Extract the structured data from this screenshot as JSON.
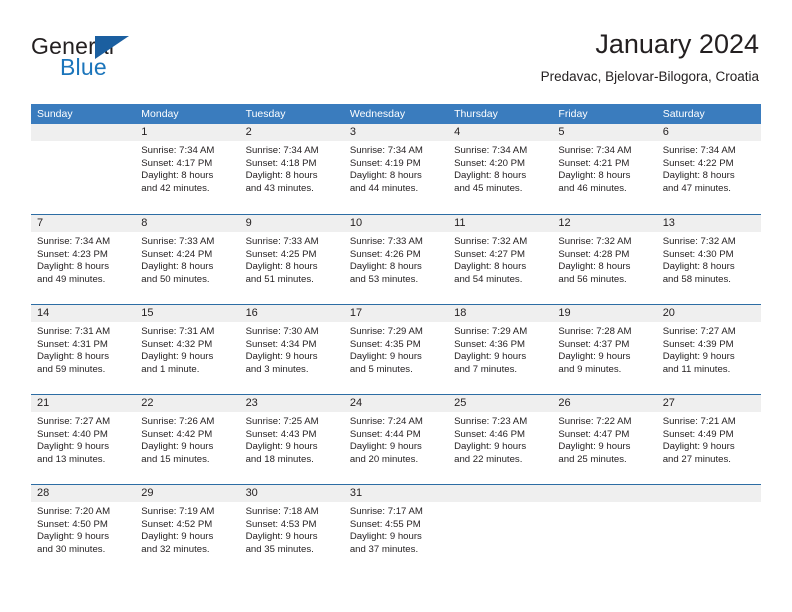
{
  "brand": {
    "name_part1": "General",
    "name_part2": "Blue"
  },
  "header": {
    "title": "January 2024",
    "subtitle": "Predavac, Bjelovar-Bilogora, Croatia"
  },
  "colors": {
    "header_blue": "#3a7cbe",
    "row_divider": "#2d6da4",
    "daynum_bg": "#efefef",
    "brand_blue": "#1b75bb",
    "text": "#231f20"
  },
  "weekdays": [
    "Sunday",
    "Monday",
    "Tuesday",
    "Wednesday",
    "Thursday",
    "Friday",
    "Saturday"
  ],
  "weeks": [
    [
      {
        "day": "",
        "sunrise": "",
        "sunset": "",
        "daylight1": "",
        "daylight2": ""
      },
      {
        "day": "1",
        "sunrise": "Sunrise: 7:34 AM",
        "sunset": "Sunset: 4:17 PM",
        "daylight1": "Daylight: 8 hours",
        "daylight2": "and 42 minutes."
      },
      {
        "day": "2",
        "sunrise": "Sunrise: 7:34 AM",
        "sunset": "Sunset: 4:18 PM",
        "daylight1": "Daylight: 8 hours",
        "daylight2": "and 43 minutes."
      },
      {
        "day": "3",
        "sunrise": "Sunrise: 7:34 AM",
        "sunset": "Sunset: 4:19 PM",
        "daylight1": "Daylight: 8 hours",
        "daylight2": "and 44 minutes."
      },
      {
        "day": "4",
        "sunrise": "Sunrise: 7:34 AM",
        "sunset": "Sunset: 4:20 PM",
        "daylight1": "Daylight: 8 hours",
        "daylight2": "and 45 minutes."
      },
      {
        "day": "5",
        "sunrise": "Sunrise: 7:34 AM",
        "sunset": "Sunset: 4:21 PM",
        "daylight1": "Daylight: 8 hours",
        "daylight2": "and 46 minutes."
      },
      {
        "day": "6",
        "sunrise": "Sunrise: 7:34 AM",
        "sunset": "Sunset: 4:22 PM",
        "daylight1": "Daylight: 8 hours",
        "daylight2": "and 47 minutes."
      }
    ],
    [
      {
        "day": "7",
        "sunrise": "Sunrise: 7:34 AM",
        "sunset": "Sunset: 4:23 PM",
        "daylight1": "Daylight: 8 hours",
        "daylight2": "and 49 minutes."
      },
      {
        "day": "8",
        "sunrise": "Sunrise: 7:33 AM",
        "sunset": "Sunset: 4:24 PM",
        "daylight1": "Daylight: 8 hours",
        "daylight2": "and 50 minutes."
      },
      {
        "day": "9",
        "sunrise": "Sunrise: 7:33 AM",
        "sunset": "Sunset: 4:25 PM",
        "daylight1": "Daylight: 8 hours",
        "daylight2": "and 51 minutes."
      },
      {
        "day": "10",
        "sunrise": "Sunrise: 7:33 AM",
        "sunset": "Sunset: 4:26 PM",
        "daylight1": "Daylight: 8 hours",
        "daylight2": "and 53 minutes."
      },
      {
        "day": "11",
        "sunrise": "Sunrise: 7:32 AM",
        "sunset": "Sunset: 4:27 PM",
        "daylight1": "Daylight: 8 hours",
        "daylight2": "and 54 minutes."
      },
      {
        "day": "12",
        "sunrise": "Sunrise: 7:32 AM",
        "sunset": "Sunset: 4:28 PM",
        "daylight1": "Daylight: 8 hours",
        "daylight2": "and 56 minutes."
      },
      {
        "day": "13",
        "sunrise": "Sunrise: 7:32 AM",
        "sunset": "Sunset: 4:30 PM",
        "daylight1": "Daylight: 8 hours",
        "daylight2": "and 58 minutes."
      }
    ],
    [
      {
        "day": "14",
        "sunrise": "Sunrise: 7:31 AM",
        "sunset": "Sunset: 4:31 PM",
        "daylight1": "Daylight: 8 hours",
        "daylight2": "and 59 minutes."
      },
      {
        "day": "15",
        "sunrise": "Sunrise: 7:31 AM",
        "sunset": "Sunset: 4:32 PM",
        "daylight1": "Daylight: 9 hours",
        "daylight2": "and 1 minute."
      },
      {
        "day": "16",
        "sunrise": "Sunrise: 7:30 AM",
        "sunset": "Sunset: 4:34 PM",
        "daylight1": "Daylight: 9 hours",
        "daylight2": "and 3 minutes."
      },
      {
        "day": "17",
        "sunrise": "Sunrise: 7:29 AM",
        "sunset": "Sunset: 4:35 PM",
        "daylight1": "Daylight: 9 hours",
        "daylight2": "and 5 minutes."
      },
      {
        "day": "18",
        "sunrise": "Sunrise: 7:29 AM",
        "sunset": "Sunset: 4:36 PM",
        "daylight1": "Daylight: 9 hours",
        "daylight2": "and 7 minutes."
      },
      {
        "day": "19",
        "sunrise": "Sunrise: 7:28 AM",
        "sunset": "Sunset: 4:37 PM",
        "daylight1": "Daylight: 9 hours",
        "daylight2": "and 9 minutes."
      },
      {
        "day": "20",
        "sunrise": "Sunrise: 7:27 AM",
        "sunset": "Sunset: 4:39 PM",
        "daylight1": "Daylight: 9 hours",
        "daylight2": "and 11 minutes."
      }
    ],
    [
      {
        "day": "21",
        "sunrise": "Sunrise: 7:27 AM",
        "sunset": "Sunset: 4:40 PM",
        "daylight1": "Daylight: 9 hours",
        "daylight2": "and 13 minutes."
      },
      {
        "day": "22",
        "sunrise": "Sunrise: 7:26 AM",
        "sunset": "Sunset: 4:42 PM",
        "daylight1": "Daylight: 9 hours",
        "daylight2": "and 15 minutes."
      },
      {
        "day": "23",
        "sunrise": "Sunrise: 7:25 AM",
        "sunset": "Sunset: 4:43 PM",
        "daylight1": "Daylight: 9 hours",
        "daylight2": "and 18 minutes."
      },
      {
        "day": "24",
        "sunrise": "Sunrise: 7:24 AM",
        "sunset": "Sunset: 4:44 PM",
        "daylight1": "Daylight: 9 hours",
        "daylight2": "and 20 minutes."
      },
      {
        "day": "25",
        "sunrise": "Sunrise: 7:23 AM",
        "sunset": "Sunset: 4:46 PM",
        "daylight1": "Daylight: 9 hours",
        "daylight2": "and 22 minutes."
      },
      {
        "day": "26",
        "sunrise": "Sunrise: 7:22 AM",
        "sunset": "Sunset: 4:47 PM",
        "daylight1": "Daylight: 9 hours",
        "daylight2": "and 25 minutes."
      },
      {
        "day": "27",
        "sunrise": "Sunrise: 7:21 AM",
        "sunset": "Sunset: 4:49 PM",
        "daylight1": "Daylight: 9 hours",
        "daylight2": "and 27 minutes."
      }
    ],
    [
      {
        "day": "28",
        "sunrise": "Sunrise: 7:20 AM",
        "sunset": "Sunset: 4:50 PM",
        "daylight1": "Daylight: 9 hours",
        "daylight2": "and 30 minutes."
      },
      {
        "day": "29",
        "sunrise": "Sunrise: 7:19 AM",
        "sunset": "Sunset: 4:52 PM",
        "daylight1": "Daylight: 9 hours",
        "daylight2": "and 32 minutes."
      },
      {
        "day": "30",
        "sunrise": "Sunrise: 7:18 AM",
        "sunset": "Sunset: 4:53 PM",
        "daylight1": "Daylight: 9 hours",
        "daylight2": "and 35 minutes."
      },
      {
        "day": "31",
        "sunrise": "Sunrise: 7:17 AM",
        "sunset": "Sunset: 4:55 PM",
        "daylight1": "Daylight: 9 hours",
        "daylight2": "and 37 minutes."
      },
      {
        "day": "",
        "sunrise": "",
        "sunset": "",
        "daylight1": "",
        "daylight2": ""
      },
      {
        "day": "",
        "sunrise": "",
        "sunset": "",
        "daylight1": "",
        "daylight2": ""
      },
      {
        "day": "",
        "sunrise": "",
        "sunset": "",
        "daylight1": "",
        "daylight2": ""
      }
    ]
  ]
}
